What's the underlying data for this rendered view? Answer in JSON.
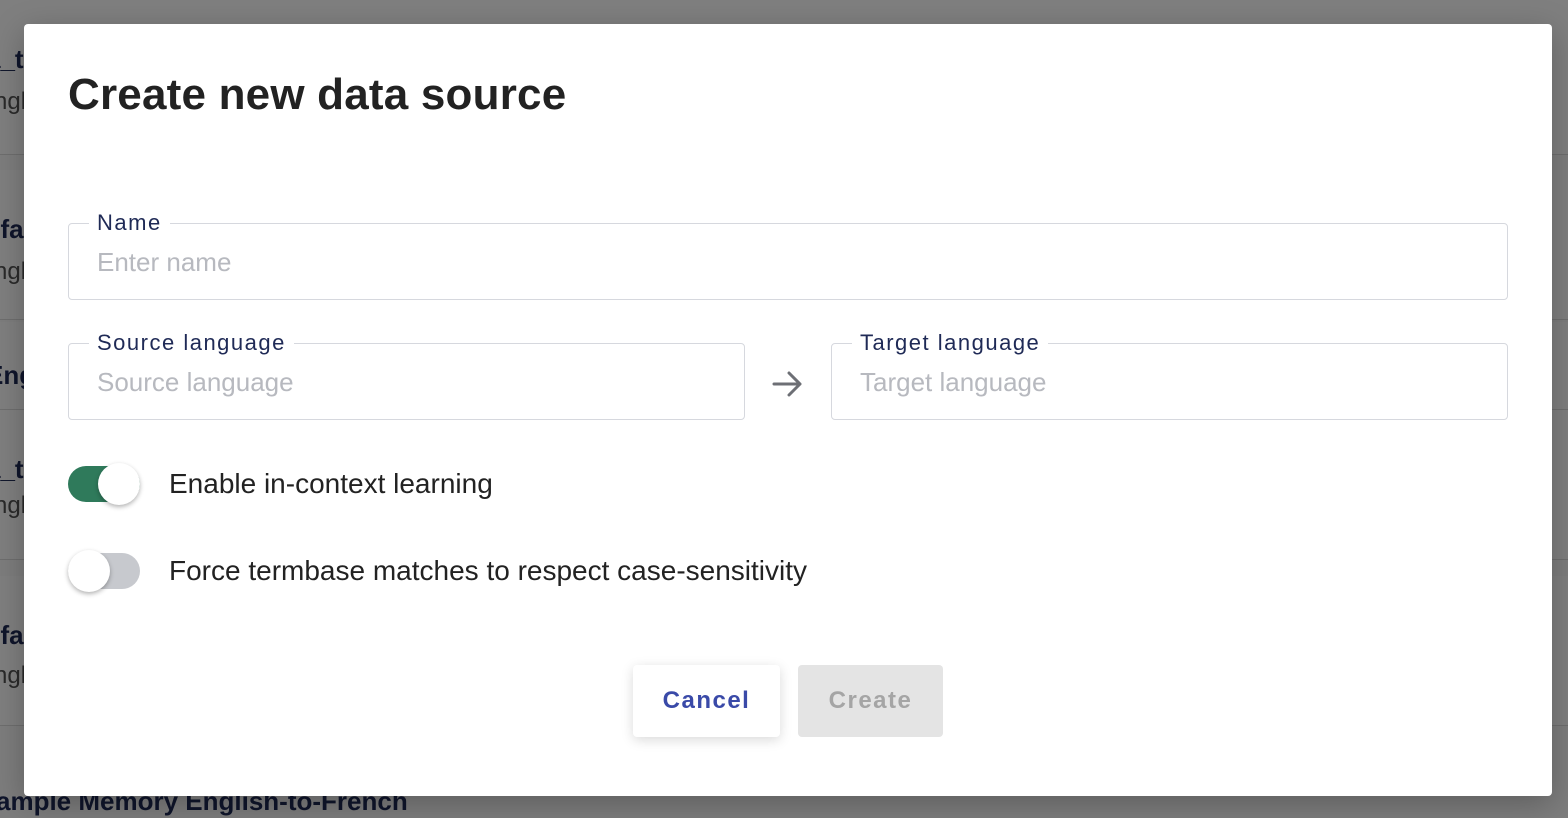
{
  "background": {
    "items": [
      {
        "title": "a_t",
        "subtitle": "ngl"
      },
      {
        "title": "efa",
        "subtitle": "ngl"
      },
      {
        "title": "Eng",
        "subtitle": ""
      },
      {
        "title": "a_t",
        "subtitle": "ngl"
      },
      {
        "title": "efa",
        "subtitle": "ngl"
      }
    ],
    "bottom_title": "ample Memory English-to-French"
  },
  "modal": {
    "title": "Create new data source",
    "name_field": {
      "label": "Name",
      "placeholder": "Enter name",
      "value": ""
    },
    "source_field": {
      "label": "Source language",
      "placeholder": "Source language",
      "value": ""
    },
    "target_field": {
      "label": "Target language",
      "placeholder": "Target language",
      "value": ""
    },
    "arrow_icon": "arrow-right-icon",
    "toggles": [
      {
        "label": "Enable in-context learning",
        "on": true
      },
      {
        "label": "Force termbase matches to respect case-sensitivity",
        "on": false
      }
    ],
    "cancel_label": "Cancel",
    "create_label": "Create",
    "create_disabled": true
  },
  "colors": {
    "accent": "#3a4aa8",
    "toggle_on": "#2f7a5b",
    "toggle_off": "#c7c9ce",
    "title_text": "#222222",
    "label_text": "#1f2a56"
  }
}
